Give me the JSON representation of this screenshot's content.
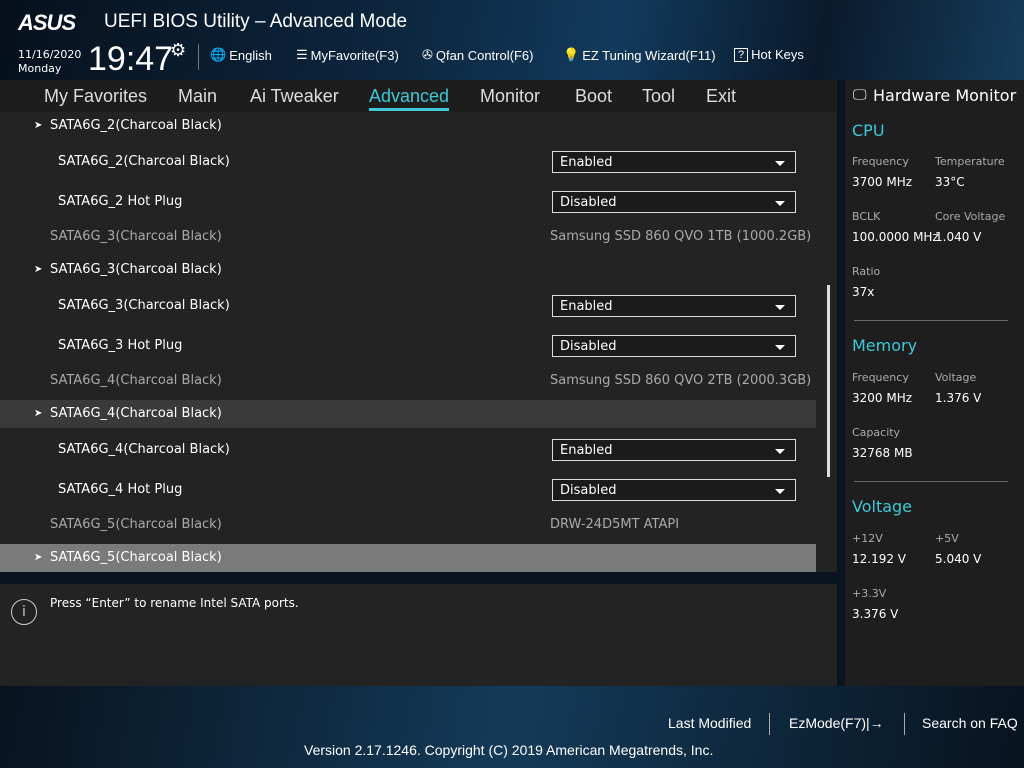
{
  "header": {
    "logo": "ASUS",
    "title": "UEFI BIOS Utility – Advanced Mode",
    "date": "11/16/2020",
    "day": "Monday",
    "time": "19:47",
    "tools": [
      {
        "icon": "globe-icon",
        "label": "English"
      },
      {
        "icon": "list-icon",
        "label": "MyFavorite(F3)"
      },
      {
        "icon": "fan-icon",
        "label": "Qfan Control(F6)"
      },
      {
        "icon": "bulb-icon",
        "label": "EZ Tuning Wizard(F11)"
      },
      {
        "icon": "help-icon",
        "label": "Hot Keys"
      }
    ]
  },
  "tabs": [
    "My Favorites",
    "Main",
    "Ai Tweaker",
    "Advanced",
    "Monitor",
    "Boot",
    "Tool",
    "Exit"
  ],
  "active_tab": "Advanced",
  "rows": [
    {
      "type": "header",
      "label": "SATA6G_2(Charcoal Black)"
    },
    {
      "type": "option",
      "label": "SATA6G_2(Charcoal Black)",
      "value": "Enabled"
    },
    {
      "type": "option",
      "label": "SATA6G_2 Hot Plug",
      "value": "Disabled"
    },
    {
      "type": "info",
      "label": "SATA6G_3(Charcoal Black)",
      "value": "Samsung SSD 860 QVO 1TB (1000.2GB)"
    },
    {
      "type": "header",
      "label": "SATA6G_3(Charcoal Black)"
    },
    {
      "type": "option",
      "label": "SATA6G_3(Charcoal Black)",
      "value": "Enabled"
    },
    {
      "type": "option",
      "label": "SATA6G_3 Hot Plug",
      "value": "Disabled"
    },
    {
      "type": "info",
      "label": "SATA6G_4(Charcoal Black)",
      "value": "Samsung SSD 860 QVO 2TB (2000.3GB)"
    },
    {
      "type": "header",
      "label": "SATA6G_4(Charcoal Black)"
    },
    {
      "type": "option",
      "label": "SATA6G_4(Charcoal Black)",
      "value": "Enabled"
    },
    {
      "type": "option",
      "label": "SATA6G_4 Hot Plug",
      "value": "Disabled"
    },
    {
      "type": "info",
      "label": "SATA6G_5(Charcoal Black)",
      "value": "DRW-24D5MT ATAPI"
    },
    {
      "type": "header",
      "label": "SATA6G_5(Charcoal Black)"
    }
  ],
  "help_text": "Press “Enter” to rename Intel SATA ports.",
  "hw": {
    "title": "Hardware Monitor",
    "cpu": {
      "title": "CPU",
      "freq_l": "Frequency",
      "freq": "3700 MHz",
      "temp_l": "Temperature",
      "temp": "33°C",
      "bclk_l": "BCLK",
      "bclk": "100.0000 MHz",
      "cv_l": "Core Voltage",
      "cv": "1.040 V",
      "ratio_l": "Ratio",
      "ratio": "37x"
    },
    "mem": {
      "title": "Memory",
      "freq_l": "Frequency",
      "freq": "3200 MHz",
      "volt_l": "Voltage",
      "volt": "1.376 V",
      "cap_l": "Capacity",
      "cap": "32768 MB"
    },
    "volt": {
      "title": "Voltage",
      "v12_l": "+12V",
      "v12": "12.192 V",
      "v5_l": "+5V",
      "v5": "5.040 V",
      "v33_l": "+3.3V",
      "v33": "3.376 V"
    }
  },
  "footer": {
    "last_modified": "Last Modified",
    "ezmode": "EzMode(F7)|→",
    "search": "Search on FAQ",
    "copyright": "Version 2.17.1246. Copyright (C) 2019 American Megatrends, Inc."
  }
}
